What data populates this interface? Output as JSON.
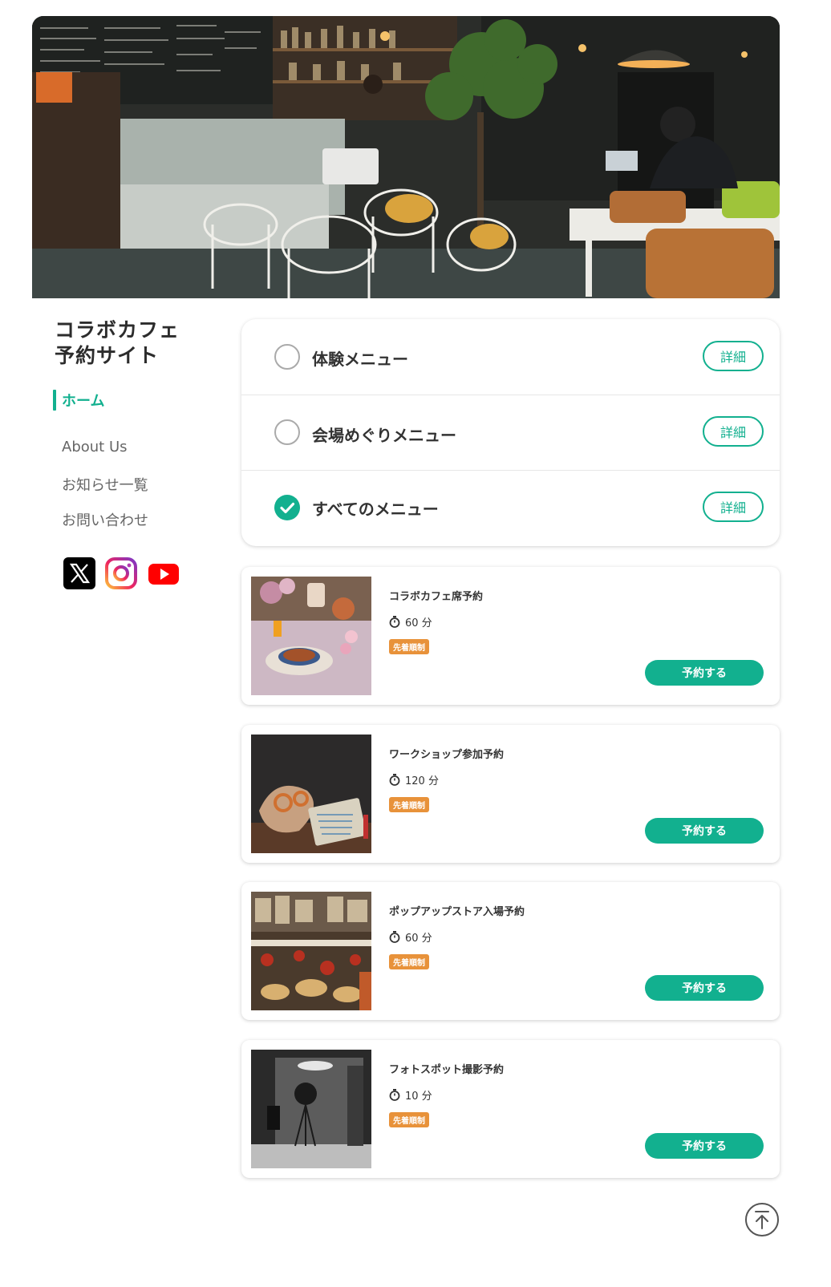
{
  "sidebar": {
    "title_line1": "コラボカフェ",
    "title_line2": "予約サイト",
    "nav_active": "ホーム",
    "nav_items": [
      "About Us",
      "お知らせ一覧",
      "お問い合わせ"
    ],
    "social_icons": [
      "x-icon",
      "instagram-icon",
      "youtube-icon"
    ]
  },
  "menu_select": {
    "detail_label": "詳細",
    "options": [
      {
        "label": "体験メニュー",
        "checked": false
      },
      {
        "label": "会場めぐりメニュー",
        "checked": false
      },
      {
        "label": "すべてのメニュー",
        "checked": true
      }
    ]
  },
  "reservations": [
    {
      "title": "コラボカフェ席予約",
      "duration": "60 分",
      "badge": "先着順制",
      "button": "予約する"
    },
    {
      "title": "ワークショップ参加予約",
      "duration": "120 分",
      "badge": "先着順制",
      "button": "予約する"
    },
    {
      "title": "ポップアップストア入場予約",
      "duration": "60 分",
      "badge": "先着順制",
      "button": "予約する"
    },
    {
      "title": "フォトスポット撮影予約",
      "duration": "10 分",
      "badge": "先着順制",
      "button": "予約する"
    }
  ],
  "colors": {
    "accent": "#12b08f",
    "badge": "#e8923a",
    "text": "#333333"
  },
  "icons": {
    "timer": "stopwatch-icon",
    "check": "check-icon",
    "back_to_top": "arrow-up-circle-icon"
  }
}
